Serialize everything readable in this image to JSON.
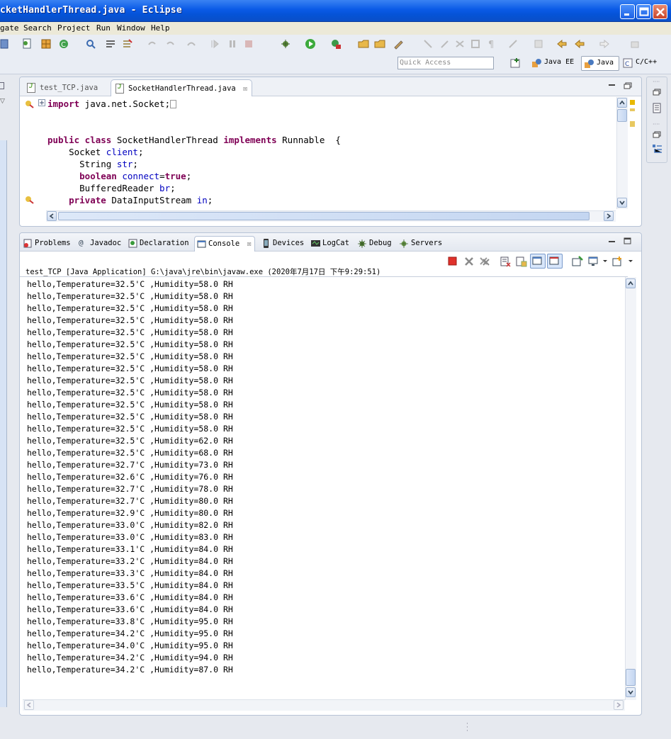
{
  "window": {
    "title": "cketHandlerThread.java - Eclipse"
  },
  "menu": [
    "gate",
    "Search",
    "Project",
    "Run",
    "Window",
    "Help"
  ],
  "toolbar": {
    "quick_access_placeholder": "Quick Access",
    "perspectives": [
      {
        "label": "Java EE",
        "active": false
      },
      {
        "label": "Java",
        "active": true
      },
      {
        "label": "C/C++",
        "active": false
      }
    ]
  },
  "editor": {
    "tabs": [
      {
        "label": "test_TCP.java",
        "active": false
      },
      {
        "label": "SocketHandlerThread.java",
        "active": true
      }
    ],
    "code": [
      "import java.net.Socket;",
      "",
      "",
      "public class SocketHandlerThread implements Runnable  {",
      "    Socket client;",
      "      String str;",
      "      boolean connect=true;",
      "      BufferedReader br;",
      "    private DataInputStream in;"
    ]
  },
  "console": {
    "tabs": [
      "Problems",
      "Javadoc",
      "Declaration",
      "Console",
      "Devices",
      "LogCat",
      "Debug",
      "Servers"
    ],
    "active_tab": "Console",
    "header": "test_TCP [Java Application] G:\\java\\jre\\bin\\javaw.exe (2020年7月17日 下午9:29:51)",
    "lines": [
      "hello,Temperature=32.5'C ,Humidity=58.0 RH",
      "hello,Temperature=32.5'C ,Humidity=58.0 RH",
      "hello,Temperature=32.5'C ,Humidity=58.0 RH",
      "hello,Temperature=32.5'C ,Humidity=58.0 RH",
      "hello,Temperature=32.5'C ,Humidity=58.0 RH",
      "hello,Temperature=32.5'C ,Humidity=58.0 RH",
      "hello,Temperature=32.5'C ,Humidity=58.0 RH",
      "hello,Temperature=32.5'C ,Humidity=58.0 RH",
      "hello,Temperature=32.5'C ,Humidity=58.0 RH",
      "hello,Temperature=32.5'C ,Humidity=58.0 RH",
      "hello,Temperature=32.5'C ,Humidity=58.0 RH",
      "hello,Temperature=32.5'C ,Humidity=58.0 RH",
      "hello,Temperature=32.5'C ,Humidity=58.0 RH",
      "hello,Temperature=32.5'C ,Humidity=62.0 RH",
      "hello,Temperature=32.5'C ,Humidity=68.0 RH",
      "hello,Temperature=32.7'C ,Humidity=73.0 RH",
      "hello,Temperature=32.6'C ,Humidity=76.0 RH",
      "hello,Temperature=32.7'C ,Humidity=78.0 RH",
      "hello,Temperature=32.7'C ,Humidity=80.0 RH",
      "hello,Temperature=32.9'C ,Humidity=80.0 RH",
      "hello,Temperature=33.0'C ,Humidity=82.0 RH",
      "hello,Temperature=33.0'C ,Humidity=83.0 RH",
      "hello,Temperature=33.1'C ,Humidity=84.0 RH",
      "hello,Temperature=33.2'C ,Humidity=84.0 RH",
      "hello,Temperature=33.3'C ,Humidity=84.0 RH",
      "hello,Temperature=33.5'C ,Humidity=84.0 RH",
      "hello,Temperature=33.6'C ,Humidity=84.0 RH",
      "hello,Temperature=33.6'C ,Humidity=84.0 RH",
      "hello,Temperature=33.8'C ,Humidity=95.0 RH",
      "hello,Temperature=34.2'C ,Humidity=95.0 RH",
      "hello,Temperature=34.0'C ,Humidity=95.0 RH",
      "hello,Temperature=34.2'C ,Humidity=94.0 RH",
      "hello,Temperature=34.2'C ,Humidity=87.0 RH"
    ]
  },
  "colors": {
    "titlebar": "#0a5ae6",
    "keyword": "#7f0055",
    "field": "#0000c0",
    "terminate": "#e0312b"
  }
}
